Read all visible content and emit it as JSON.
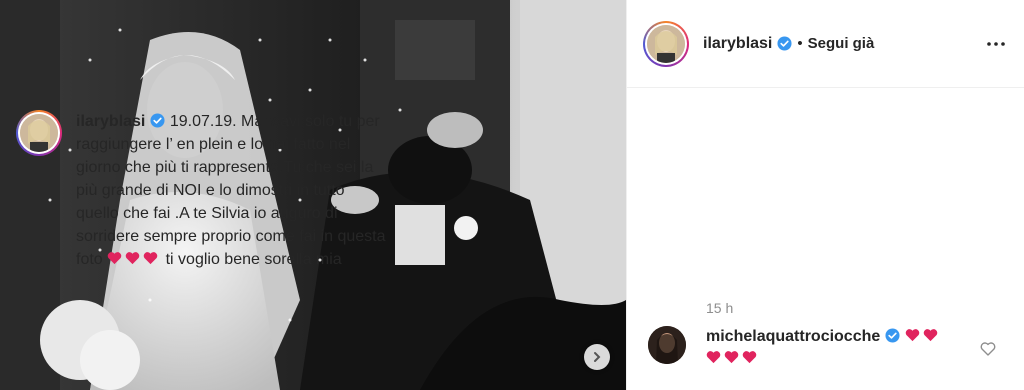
{
  "post": {
    "author": "ilaryblasi",
    "follow_label": "Segui già",
    "separator": "•",
    "verified": true,
    "photo_description_icon": "wedding-photo",
    "more_icon": "more-horizontal-icon",
    "next_icon": "chevron-right-icon"
  },
  "caption": {
    "author": "ilaryblasi",
    "text": "19.07.19. Mancavi solo tu per raggiungere l’ en plein e lo hai fatto nel giorno che più ti rappresenta.Tu che sei la più grande di NOI e lo dimostri in tutto quello che fai .A te Silvia io auguro di sorridere sempre proprio come fai in questa foto",
    "hearts_emoji": "❤️❤️❤️",
    "tail": "ti voglio bene sorella mia",
    "time": "15 h"
  },
  "comments": [
    {
      "author": "michelaquattrociocche",
      "verified": true,
      "text": "❤️❤️❤️❤️❤️",
      "like_icon": "heart-outline-icon"
    }
  ],
  "colors": {
    "verified": "#3897f0",
    "heart": "#e0245e",
    "muted": "#8e8e8e",
    "text": "#262626"
  }
}
